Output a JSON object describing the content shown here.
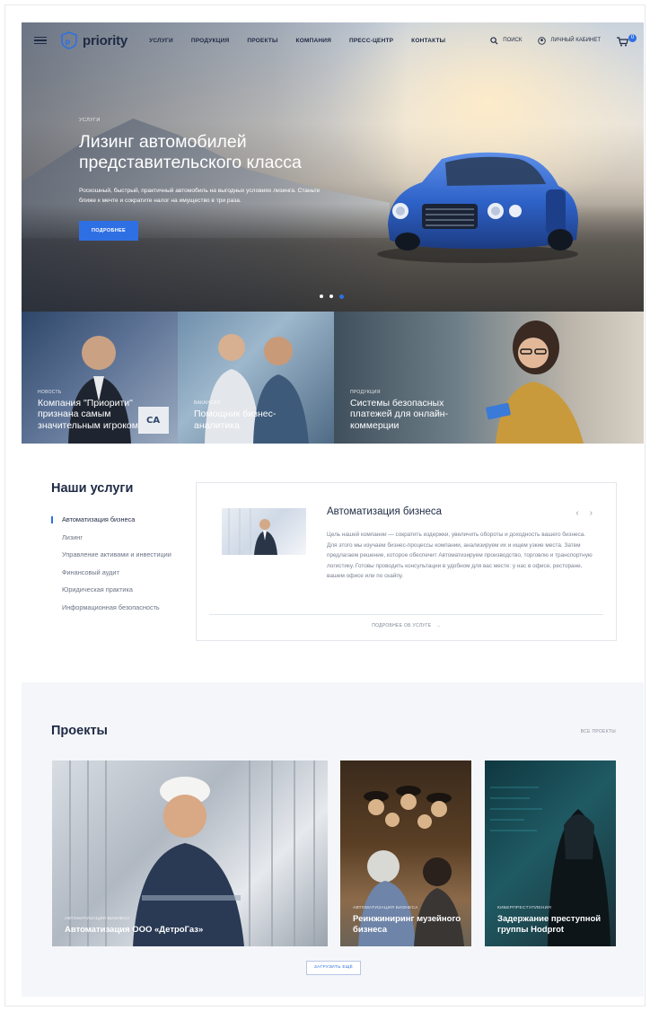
{
  "header": {
    "logo_text": "priority",
    "nav": [
      "УСЛУГИ",
      "ПРОДУКЦИЯ",
      "ПРОЕКТЫ",
      "КОМПАНИЯ",
      "ПРЕСС-ЦЕНТР",
      "КОНТАКТЫ"
    ],
    "search_label": "ПОИСК",
    "account_label": "ЛИЧНЫЙ КАБИНЕТ",
    "cart_count": "0",
    "accent_color": "#2f6fe4"
  },
  "hero": {
    "kicker": "УСЛУГИ",
    "title": "Лизинг автомобилей представительского класса",
    "description": "Роскошный, быстрый, практичный автомобиль на выгодных условиях лизинга. Станьте ближе к мечте и сократите налог на имущество в три раза.",
    "button": "ПОДРОБНЕЕ",
    "slides_total": 3,
    "active_slide": 3
  },
  "tiles": [
    {
      "kicker": "НОВОСТЬ",
      "title": "Компания \"Приорити\" признана самым значительным игроком"
    },
    {
      "kicker": "ВАКАНСИЯ",
      "title": "Помощник бизнес-аналитика"
    },
    {
      "kicker": "ПРОДУКЦИЯ",
      "title": "Системы безопасных платежей для онлайн-коммерции"
    }
  ],
  "services": {
    "title": "Наши услуги",
    "items": [
      "Автоматизация бизнеса",
      "Лизинг",
      "Управление активами и инвестиции",
      "Финансовый аудит",
      "Юридическая практика",
      "Информационная безопасность"
    ],
    "active_index": 0,
    "card": {
      "title": "Автоматизация бизнеса",
      "description": "Цель нашей компании — сократить издержки, увеличить обороты и доходность вашего бизнеса. Для этого мы изучаем бизнес-процессы компании, анализируем их и ищем узкие места. Затем предлагаем решение, которое обеспечит Автоматизируем производство, торговлю и транспортную логистику. Готовы проводить консультации в удобном для вас месте: у нас в офисе, ресторане, вашем офисе или по скайпу.",
      "more": "ПОДРОБНЕЕ ОБ УСЛУГЕ"
    }
  },
  "projects": {
    "title": "Проекты",
    "all": "ВСЕ ПРОЕКТЫ",
    "items": [
      {
        "kicker": "АВТОМАТИЗАЦИЯ БИЗНЕСА",
        "title": "Автоматизация ООО «ДетроГаз»"
      },
      {
        "kicker": "АВТОМАТИЗАЦИЯ БИЗНЕСА",
        "title": "Реинжиниринг музейного бизнеса"
      },
      {
        "kicker": "КИБЕРПРЕСТУПЛЕНИЯ",
        "title": "Задержание преступной группы Hodprot"
      }
    ],
    "load_more": "ЗАГРУЗИТЬ ЕЩЁ"
  }
}
